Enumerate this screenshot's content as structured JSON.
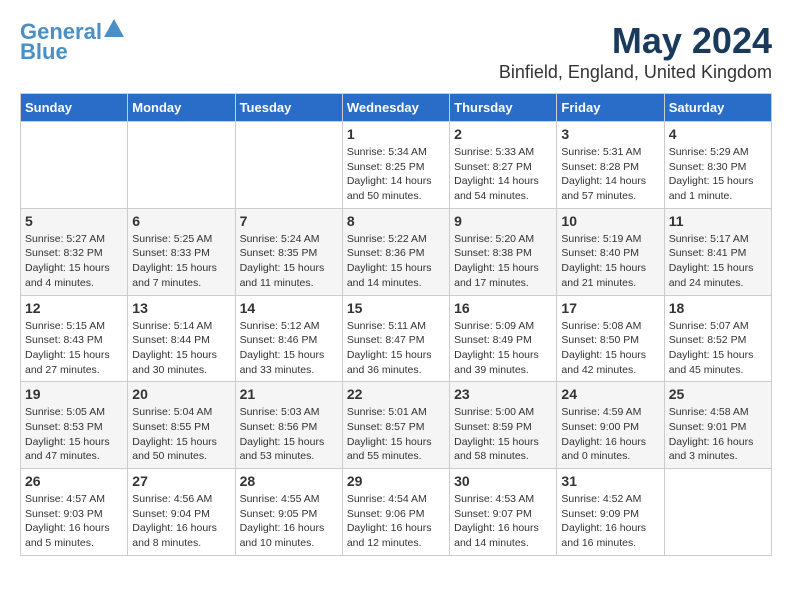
{
  "header": {
    "logo_line1": "General",
    "logo_line2": "Blue",
    "month_year": "May 2024",
    "location": "Binfield, England, United Kingdom"
  },
  "weekdays": [
    "Sunday",
    "Monday",
    "Tuesday",
    "Wednesday",
    "Thursday",
    "Friday",
    "Saturday"
  ],
  "weeks": [
    [
      {
        "day": "",
        "info": ""
      },
      {
        "day": "",
        "info": ""
      },
      {
        "day": "",
        "info": ""
      },
      {
        "day": "1",
        "info": "Sunrise: 5:34 AM\nSunset: 8:25 PM\nDaylight: 14 hours\nand 50 minutes."
      },
      {
        "day": "2",
        "info": "Sunrise: 5:33 AM\nSunset: 8:27 PM\nDaylight: 14 hours\nand 54 minutes."
      },
      {
        "day": "3",
        "info": "Sunrise: 5:31 AM\nSunset: 8:28 PM\nDaylight: 14 hours\nand 57 minutes."
      },
      {
        "day": "4",
        "info": "Sunrise: 5:29 AM\nSunset: 8:30 PM\nDaylight: 15 hours\nand 1 minute."
      }
    ],
    [
      {
        "day": "5",
        "info": "Sunrise: 5:27 AM\nSunset: 8:32 PM\nDaylight: 15 hours\nand 4 minutes."
      },
      {
        "day": "6",
        "info": "Sunrise: 5:25 AM\nSunset: 8:33 PM\nDaylight: 15 hours\nand 7 minutes."
      },
      {
        "day": "7",
        "info": "Sunrise: 5:24 AM\nSunset: 8:35 PM\nDaylight: 15 hours\nand 11 minutes."
      },
      {
        "day": "8",
        "info": "Sunrise: 5:22 AM\nSunset: 8:36 PM\nDaylight: 15 hours\nand 14 minutes."
      },
      {
        "day": "9",
        "info": "Sunrise: 5:20 AM\nSunset: 8:38 PM\nDaylight: 15 hours\nand 17 minutes."
      },
      {
        "day": "10",
        "info": "Sunrise: 5:19 AM\nSunset: 8:40 PM\nDaylight: 15 hours\nand 21 minutes."
      },
      {
        "day": "11",
        "info": "Sunrise: 5:17 AM\nSunset: 8:41 PM\nDaylight: 15 hours\nand 24 minutes."
      }
    ],
    [
      {
        "day": "12",
        "info": "Sunrise: 5:15 AM\nSunset: 8:43 PM\nDaylight: 15 hours\nand 27 minutes."
      },
      {
        "day": "13",
        "info": "Sunrise: 5:14 AM\nSunset: 8:44 PM\nDaylight: 15 hours\nand 30 minutes."
      },
      {
        "day": "14",
        "info": "Sunrise: 5:12 AM\nSunset: 8:46 PM\nDaylight: 15 hours\nand 33 minutes."
      },
      {
        "day": "15",
        "info": "Sunrise: 5:11 AM\nSunset: 8:47 PM\nDaylight: 15 hours\nand 36 minutes."
      },
      {
        "day": "16",
        "info": "Sunrise: 5:09 AM\nSunset: 8:49 PM\nDaylight: 15 hours\nand 39 minutes."
      },
      {
        "day": "17",
        "info": "Sunrise: 5:08 AM\nSunset: 8:50 PM\nDaylight: 15 hours\nand 42 minutes."
      },
      {
        "day": "18",
        "info": "Sunrise: 5:07 AM\nSunset: 8:52 PM\nDaylight: 15 hours\nand 45 minutes."
      }
    ],
    [
      {
        "day": "19",
        "info": "Sunrise: 5:05 AM\nSunset: 8:53 PM\nDaylight: 15 hours\nand 47 minutes."
      },
      {
        "day": "20",
        "info": "Sunrise: 5:04 AM\nSunset: 8:55 PM\nDaylight: 15 hours\nand 50 minutes."
      },
      {
        "day": "21",
        "info": "Sunrise: 5:03 AM\nSunset: 8:56 PM\nDaylight: 15 hours\nand 53 minutes."
      },
      {
        "day": "22",
        "info": "Sunrise: 5:01 AM\nSunset: 8:57 PM\nDaylight: 15 hours\nand 55 minutes."
      },
      {
        "day": "23",
        "info": "Sunrise: 5:00 AM\nSunset: 8:59 PM\nDaylight: 15 hours\nand 58 minutes."
      },
      {
        "day": "24",
        "info": "Sunrise: 4:59 AM\nSunset: 9:00 PM\nDaylight: 16 hours\nand 0 minutes."
      },
      {
        "day": "25",
        "info": "Sunrise: 4:58 AM\nSunset: 9:01 PM\nDaylight: 16 hours\nand 3 minutes."
      }
    ],
    [
      {
        "day": "26",
        "info": "Sunrise: 4:57 AM\nSunset: 9:03 PM\nDaylight: 16 hours\nand 5 minutes."
      },
      {
        "day": "27",
        "info": "Sunrise: 4:56 AM\nSunset: 9:04 PM\nDaylight: 16 hours\nand 8 minutes."
      },
      {
        "day": "28",
        "info": "Sunrise: 4:55 AM\nSunset: 9:05 PM\nDaylight: 16 hours\nand 10 minutes."
      },
      {
        "day": "29",
        "info": "Sunrise: 4:54 AM\nSunset: 9:06 PM\nDaylight: 16 hours\nand 12 minutes."
      },
      {
        "day": "30",
        "info": "Sunrise: 4:53 AM\nSunset: 9:07 PM\nDaylight: 16 hours\nand 14 minutes."
      },
      {
        "day": "31",
        "info": "Sunrise: 4:52 AM\nSunset: 9:09 PM\nDaylight: 16 hours\nand 16 minutes."
      },
      {
        "day": "",
        "info": ""
      }
    ]
  ]
}
